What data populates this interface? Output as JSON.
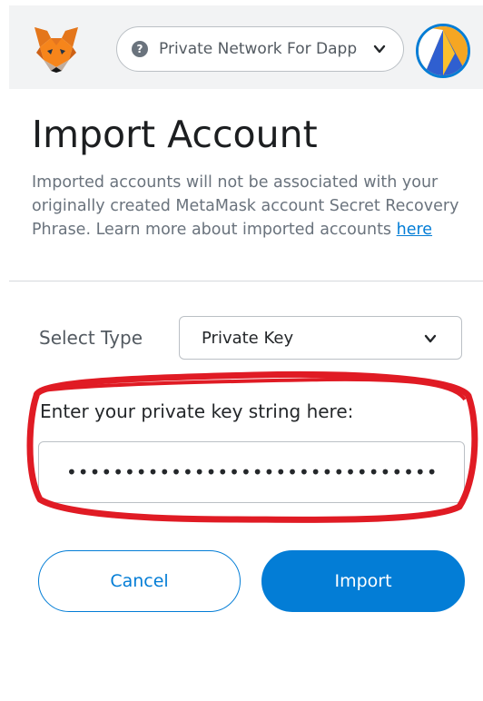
{
  "header": {
    "network": "Private Network For Dapp",
    "network_icon_glyph": "?",
    "logo_icon": "metamask-fox-icon",
    "avatar_icon": "account-avatar-icon"
  },
  "page": {
    "title": "Import Account",
    "description": "Imported accounts will not be associated with your originally created MetaMask account Secret Recovery Phrase. Learn more about imported accounts ",
    "link_text": "here"
  },
  "form": {
    "select_label": "Select Type",
    "select_value": "Private Key",
    "key_label": "Enter your private key string here:",
    "key_value": "••••••••••••••••••••••••••••••••••••••••"
  },
  "buttons": {
    "cancel": "Cancel",
    "import": "Import"
  },
  "colors": {
    "primary": "#037dd6",
    "header_bg": "#f2f3f4",
    "annotation": "#e01b24"
  }
}
